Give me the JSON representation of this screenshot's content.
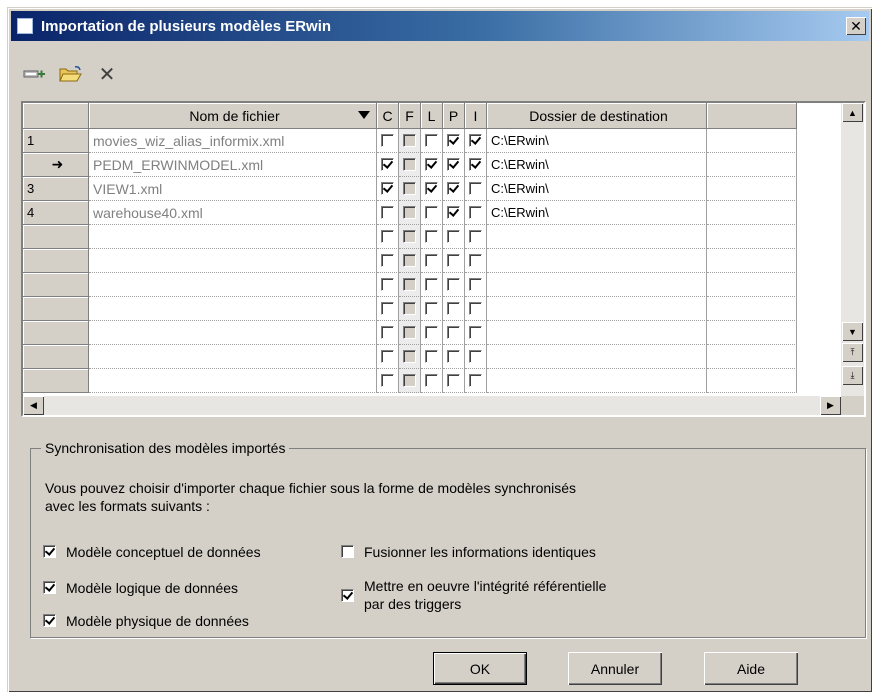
{
  "window": {
    "title": "Importation de plusieurs modèles ERwin",
    "close_glyph": "✕"
  },
  "toolbar": {
    "icons": [
      "add-row-icon",
      "open-folder-icon",
      "delete-icon"
    ],
    "delete_glyph": "✕"
  },
  "grid": {
    "columns": {
      "name": "Nom de fichier",
      "c": "C",
      "f": "F",
      "l": "L",
      "p": "P",
      "i": "I",
      "dest": "Dossier de destination"
    },
    "rows": [
      {
        "marker": "1",
        "name": "movies_wiz_alias_informix.xml",
        "c": false,
        "f": false,
        "l": false,
        "p": true,
        "i": true,
        "dest": "C:\\ERwin\\"
      },
      {
        "marker": "➜",
        "name": "PEDM_ERWINMODEL.xml",
        "c": true,
        "f": false,
        "l": true,
        "p": true,
        "i": true,
        "dest": "C:\\ERwin\\"
      },
      {
        "marker": "3",
        "name": "VIEW1.xml",
        "c": true,
        "f": false,
        "l": true,
        "p": true,
        "i": false,
        "dest": "C:\\ERwin\\"
      },
      {
        "marker": "4",
        "name": "warehouse40.xml",
        "c": false,
        "f": false,
        "l": false,
        "p": true,
        "i": false,
        "dest": "C:\\ERwin\\"
      }
    ],
    "empty_rows": 7
  },
  "sync": {
    "legend": "Synchronisation des modèles importés",
    "description_line1": "Vous pouvez choisir d'importer chaque fichier sous la forme de modèles synchronisés",
    "description_line2": "avec les formats suivants :",
    "options": {
      "conceptual": {
        "label": "Modèle conceptuel de données",
        "checked": true
      },
      "logical": {
        "label": "Modèle logique de données",
        "checked": true
      },
      "physical": {
        "label": "Modèle physique de données",
        "checked": true
      },
      "merge": {
        "label": "Fusionner les informations identiques",
        "checked": false
      },
      "triggers_line1": "Mettre en oeuvre l'intégrité référentielle",
      "triggers_line2": "par des triggers",
      "triggers_checked": true
    }
  },
  "buttons": {
    "ok": "OK",
    "cancel": "Annuler",
    "help": "Aide"
  },
  "colors": {
    "titlebar": "#0a246a",
    "face": "#d4d0c8"
  }
}
